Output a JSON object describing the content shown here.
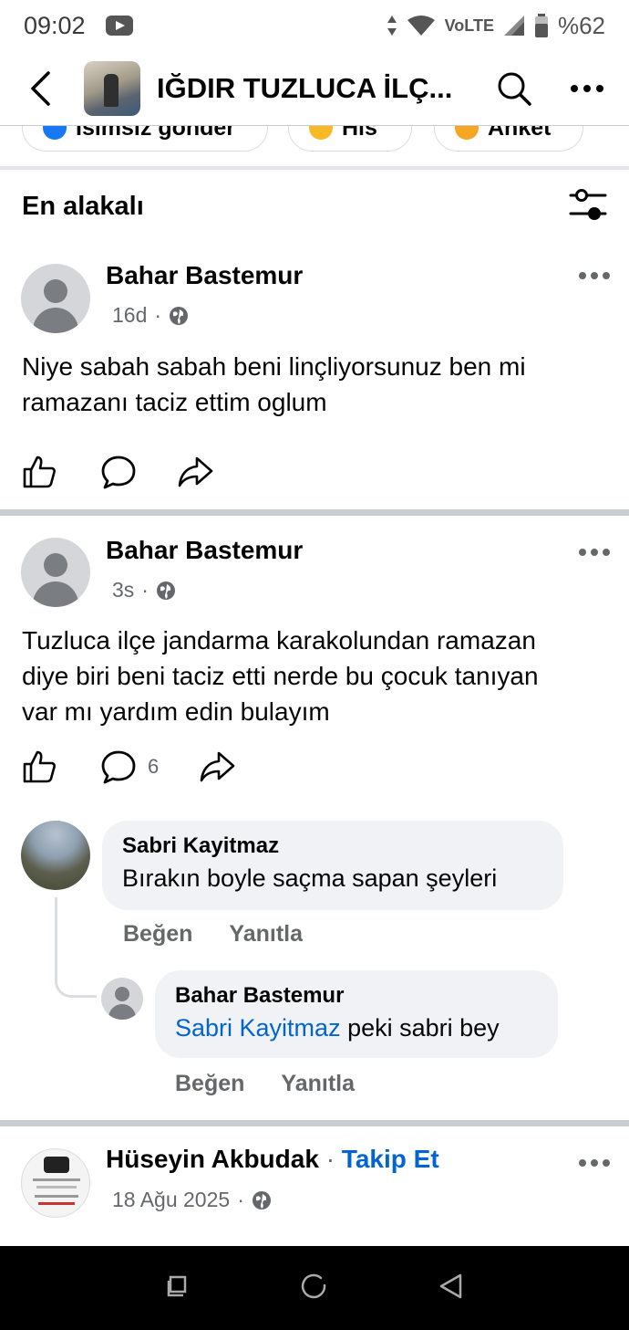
{
  "status_bar": {
    "time": "09:02",
    "network": "VoLTE",
    "battery": "%62"
  },
  "header": {
    "title": "IĞDIR TUZLUCA İLÇ..."
  },
  "chips": [
    {
      "label": "İsimsiz gönder"
    },
    {
      "label": "His"
    },
    {
      "label": "Anket"
    }
  ],
  "sort": {
    "label": "En alakalı"
  },
  "posts": [
    {
      "author": "Bahar Bastemur",
      "time": "16d",
      "text_line1": "Niye sabah sabah beni linçliyorsunuz ben mi",
      "text_line2": "ramazanı taciz ettim oglum"
    },
    {
      "author": "Bahar Bastemur",
      "time": "3s",
      "text_line1": "Tuzluca ilçe jandarma karakolundan ramazan",
      "text_line2": "diye biri beni taciz etti nerde bu çocuk tanıyan",
      "text_line3": "var mı yardım edin bulayım",
      "comment_count": "6",
      "comments": [
        {
          "author": "Sabri Kayitmaz",
          "text": "Bırakın boyle saçma sapan şeyleri",
          "like": "Beğen",
          "reply": "Yanıtla"
        },
        {
          "author": "Bahar Bastemur",
          "mention": "Sabri Kayitmaz",
          "text": " peki sabri bey",
          "like": "Beğen",
          "reply": "Yanıtla"
        }
      ]
    },
    {
      "author": "Hüseyin Akbudak",
      "separator": " · ",
      "follow": "Takip Et",
      "time": "18 Ağu 2025"
    }
  ]
}
